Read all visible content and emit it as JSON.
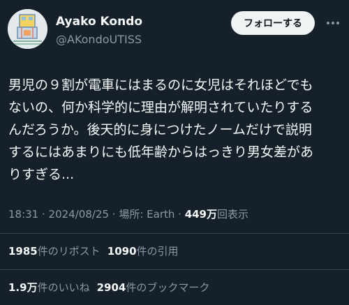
{
  "author": {
    "name": "Ayako Kondo",
    "handle": "@AKondoUTISS"
  },
  "follow_button_label": "フォローする",
  "more_icon": "more-horizontal-icon",
  "tweet": {
    "lines": [
      "男児の９割が電車にはまるのに女児はそれほどでも",
      "ないの、何か科学的に理由が解明されていたりする",
      "んだろうか。後天的に身につけたノームだけで説明",
      "するにはあまりにも低年齢からはっきり男女差があ",
      "りすぎる..."
    ]
  },
  "meta": {
    "time": "18:31",
    "separator": " · ",
    "date": "2024/08/25",
    "location": "場所: Earth",
    "views_count": "449万",
    "views_label": "回表示"
  },
  "stats": {
    "reposts_count": "1985",
    "reposts_label": "件のリポスト",
    "quotes_count": "1090",
    "quotes_label": "件の引用",
    "likes_count": "1.9万",
    "likes_label": "件のいいね",
    "bookmarks_count": "2904",
    "bookmarks_label": "件のブックマーク"
  },
  "colors": {
    "background": "#15202b",
    "text_primary": "#f7f9f9",
    "text_secondary": "#8b98a5",
    "divider": "#38444d",
    "follow_button_bg": "#eff3f4"
  }
}
